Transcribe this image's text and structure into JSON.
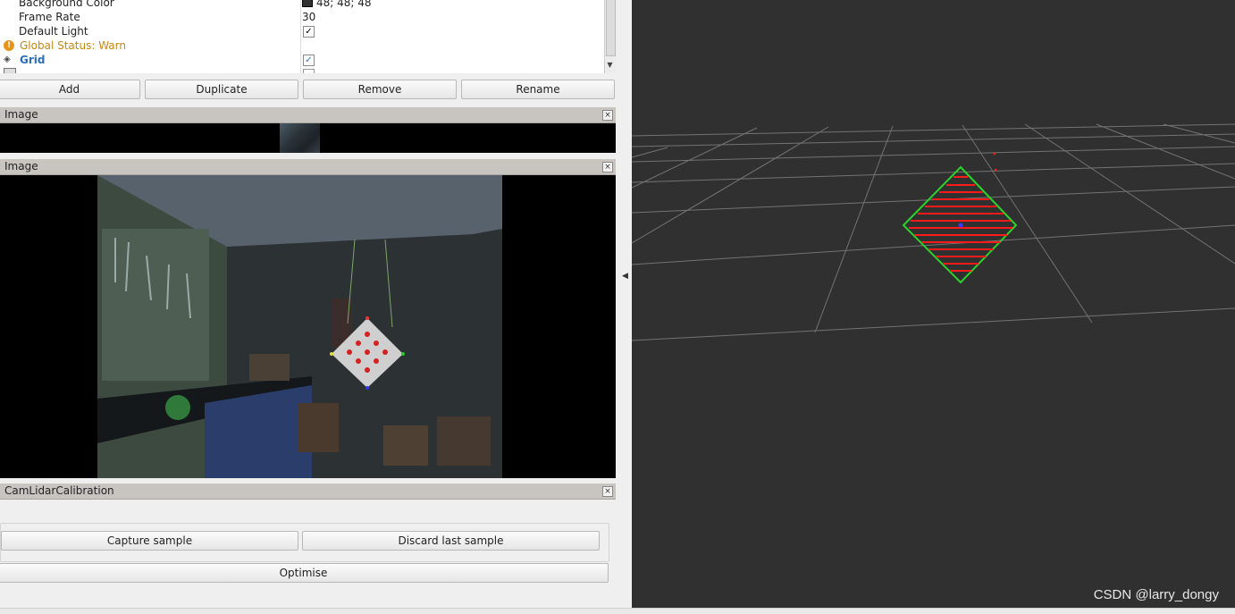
{
  "displays": {
    "properties": [
      {
        "name": "Background Color",
        "value": "48; 48; 48"
      },
      {
        "name": "Frame Rate",
        "value": "30"
      },
      {
        "name": "Default Light",
        "value": "✓"
      }
    ],
    "status": {
      "label": "Global Status: Warn",
      "color": "#c8860f"
    },
    "grid": {
      "label": "Grid",
      "value": "✓",
      "color": "#2a6fbf"
    }
  },
  "buttons": {
    "add": "Add",
    "duplicate": "Duplicate",
    "remove": "Remove",
    "rename": "Rename"
  },
  "panels": {
    "image_small": {
      "title": "Image"
    },
    "image_main": {
      "title": "Image"
    },
    "calibration": {
      "title": "CamLidarCalibration",
      "capture": "Capture sample",
      "discard": "Discard last sample",
      "optimise": "Optimise"
    }
  },
  "close_glyph": "×",
  "viewport": {
    "background": "#303030",
    "grid_color": "#8a8a8a",
    "points_color": "#ff1a1a",
    "board_outline": "#2bd42b"
  },
  "watermark": "CSDN @larry_dongy"
}
